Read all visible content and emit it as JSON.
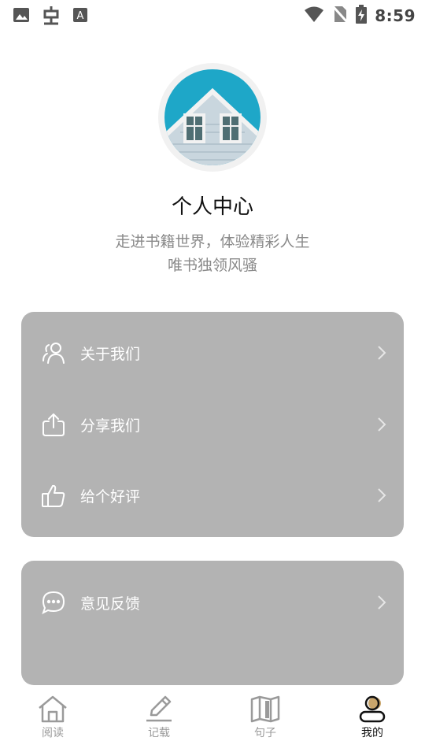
{
  "status_bar": {
    "time": "8:59"
  },
  "profile": {
    "title": "个人中心",
    "tagline_1": "走进书籍世界，体验精彩人生",
    "tagline_2": "唯书独领风骚"
  },
  "menu_card_1": {
    "items": [
      {
        "label": "关于我们",
        "icon": "people-icon"
      },
      {
        "label": "分享我们",
        "icon": "share-icon"
      },
      {
        "label": "给个好评",
        "icon": "thumbs-up-icon"
      }
    ]
  },
  "menu_card_2": {
    "items": [
      {
        "label": "意见反馈",
        "icon": "chat-bubble-icon"
      }
    ]
  },
  "tab_bar": {
    "tabs": [
      {
        "label": "阅读",
        "icon": "home-icon"
      },
      {
        "label": "记载",
        "icon": "pen-icon"
      },
      {
        "label": "句子",
        "icon": "book-icon"
      },
      {
        "label": "我的",
        "icon": "person-icon"
      }
    ],
    "active_index": 3
  },
  "colors": {
    "card": "#b3b3b3",
    "avatar_sky": "#1ea7c8",
    "active_tab": "#111111",
    "inactive_tab": "#9a9a9a"
  }
}
